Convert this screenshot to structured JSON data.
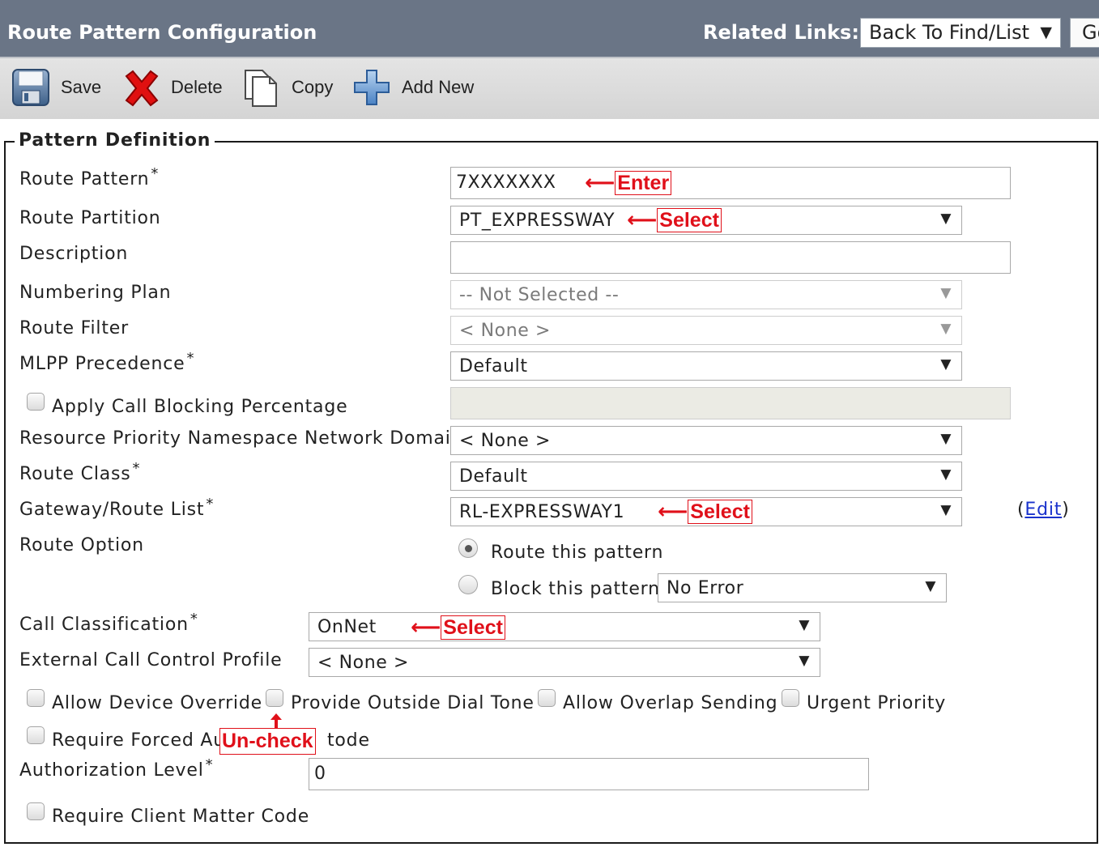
{
  "header": {
    "title": "Route Pattern Configuration",
    "related_links_label": "Related Links:",
    "related_links_value": "Back To Find/List",
    "go_label": "Go"
  },
  "toolbar": {
    "save": "Save",
    "delete": "Delete",
    "copy": "Copy",
    "add_new": "Add New"
  },
  "section": {
    "legend": "Pattern Definition"
  },
  "fields": {
    "route_pattern": {
      "label": "Route Pattern",
      "value": "7XXXXXXX"
    },
    "route_partition": {
      "label": "Route Partition",
      "value": "PT_EXPRESSWAY"
    },
    "description": {
      "label": "Description",
      "value": ""
    },
    "numbering_plan": {
      "label": "Numbering Plan",
      "value": "-- Not Selected --"
    },
    "route_filter": {
      "label": "Route Filter",
      "value": "< None >"
    },
    "mlpp_precedence": {
      "label": "MLPP Precedence",
      "value": "Default"
    },
    "apply_call_blocking": {
      "label": "Apply Call Blocking Percentage"
    },
    "resource_priority": {
      "label": "Resource Priority Namespace Network Domain",
      "value": "< None >"
    },
    "route_class": {
      "label": "Route Class",
      "value": "Default"
    },
    "gateway_route_list": {
      "label": "Gateway/Route List",
      "value": "RL-EXPRESSWAY1",
      "paren_open": "(",
      "edit": "Edit",
      "paren_close": ")"
    },
    "route_option": {
      "label": "Route Option",
      "route_this": "Route this pattern",
      "block_this": "Block this pattern",
      "block_reason": "No Error"
    },
    "call_classification": {
      "label": "Call Classification",
      "value": "OnNet"
    },
    "external_call_control": {
      "label": "External Call Control Profile",
      "value": "< None >"
    },
    "allow_device_override": {
      "label": "Allow Device Override"
    },
    "provide_outside_dial_tone": {
      "label": "Provide Outside Dial Tone"
    },
    "allow_overlap_sending": {
      "label": "Allow Overlap Sending"
    },
    "urgent_priority": {
      "label": "Urgent Priority"
    },
    "require_forced_auth": {
      "label_start": "Require Forced Au",
      "label_end": "tode"
    },
    "authorization_level": {
      "label": "Authorization Level",
      "value": "0"
    },
    "require_client_matter": {
      "label": "Require Client Matter Code"
    }
  },
  "annotations": {
    "enter": "Enter",
    "select_partition": "Select",
    "select_route_list": "Select",
    "select_classification": "Select",
    "uncheck": "Un-check"
  },
  "required_mark": "*",
  "colors": {
    "header_bg": "#6a7586",
    "annotation_red": "#e0101a",
    "link_blue": "#1a33cc"
  },
  "icons": [
    "save-icon",
    "delete-icon",
    "copy-icon",
    "add-new-icon",
    "dropdown-arrow-icon",
    "up-arrow-icon",
    "left-arrow-icon"
  ]
}
